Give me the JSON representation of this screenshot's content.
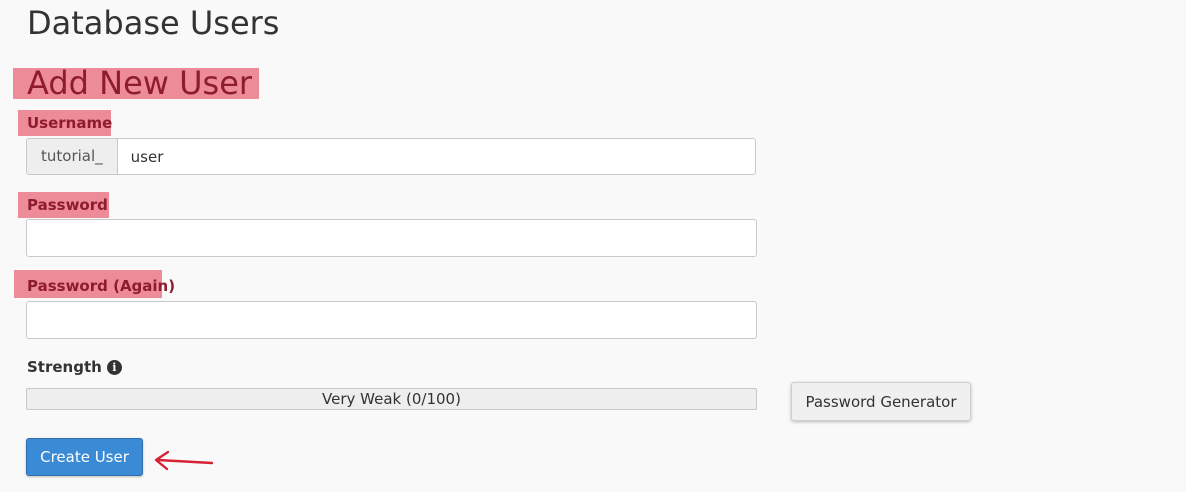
{
  "page_title": "Database Users",
  "section_title": "Add New User",
  "form": {
    "username_label": "Username",
    "username_prefix": "tutorial_",
    "username_value": "user",
    "password_label": "Password",
    "password_value": "",
    "password_again_label": "Password (Again)",
    "password_again_value": "",
    "strength_label": "Strength",
    "strength_info_icon": "info-circle-icon",
    "strength_text": "Very Weak (0/100)",
    "strength_value": 0,
    "strength_max": 100,
    "password_generator_label": "Password Generator",
    "create_user_label": "Create User"
  },
  "annotations": {
    "highlight_color": "#e85c70",
    "arrow_color": "#d62235",
    "arrow_icon": "left-arrow-icon"
  },
  "colors": {
    "primary_button": "#3b8ad6",
    "label_text": "#8e1c2c"
  }
}
